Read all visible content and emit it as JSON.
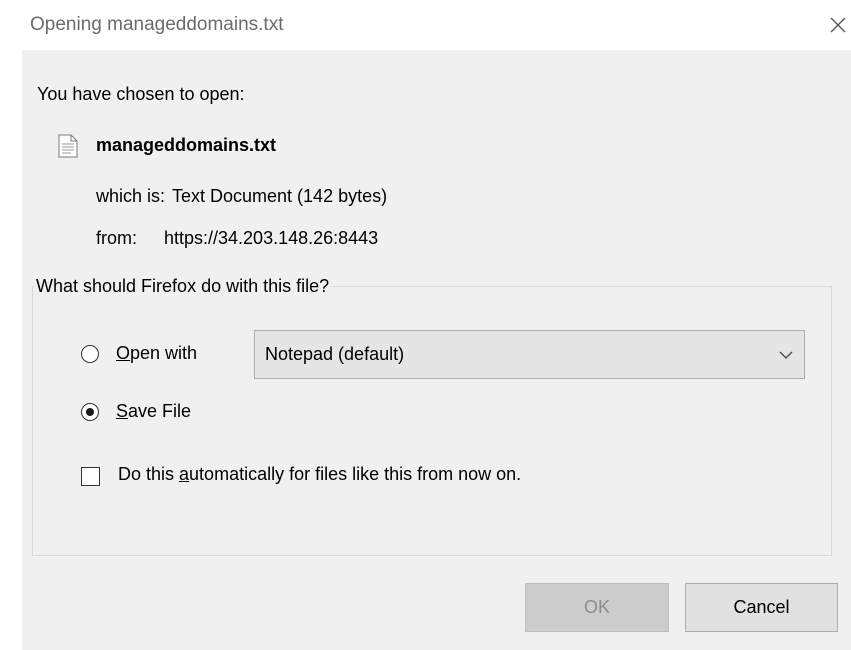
{
  "window": {
    "title": "Opening manageddomains.txt",
    "close_icon": "close-icon"
  },
  "intro": "You have chosen to open:",
  "file": {
    "icon": "text-file-icon",
    "name": "manageddomains.txt",
    "which_is_label": "which is:",
    "which_is_value": "Text Document (142 bytes)",
    "from_label": "from:",
    "from_value": "https://34.203.148.26:8443"
  },
  "action_group": {
    "legend": "What should Firefox do with this file?",
    "open_with": {
      "label_access_key": "O",
      "label_rest": "pen with",
      "selected": false,
      "app_value": "Notepad (default)"
    },
    "save_file": {
      "label_access_key": "S",
      "label_rest": "ave File",
      "selected": true
    },
    "auto": {
      "label_before": "Do this ",
      "label_access_key": "a",
      "label_after": "utomatically for files like this from now on.",
      "checked": false
    }
  },
  "buttons": {
    "ok": "OK",
    "cancel": "Cancel"
  },
  "colors": {
    "dialog_bg": "#f0f0f0",
    "title_text": "#6b6b6b",
    "ok_disabled_bg": "#cccccc",
    "button_bg": "#e1e1e1"
  }
}
